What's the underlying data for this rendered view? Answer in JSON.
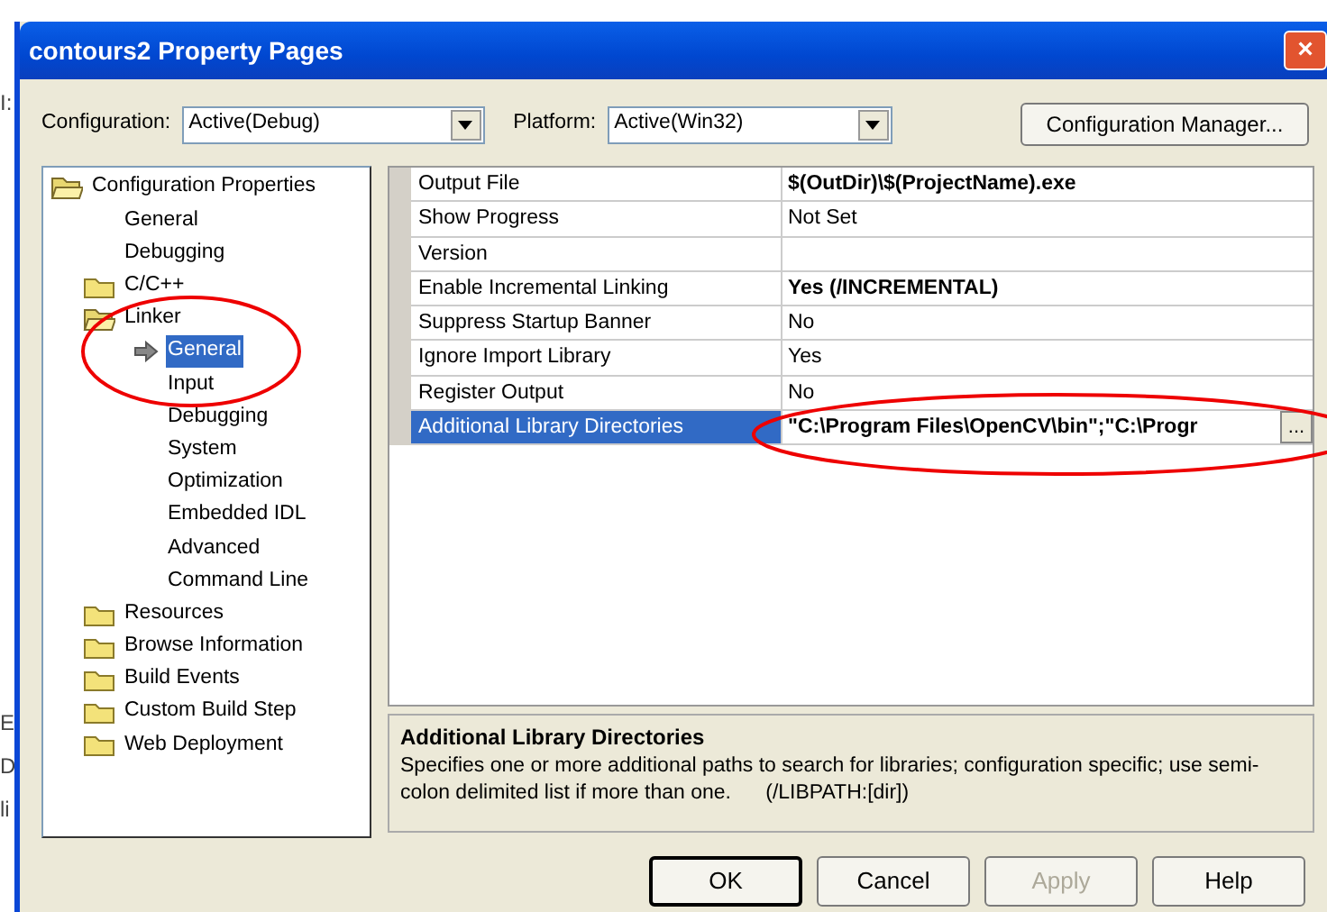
{
  "background_fragments": [
    "I:",
    "E",
    "D",
    "li"
  ],
  "window": {
    "title": "contours2 Property Pages",
    "close": "×"
  },
  "config_bar": {
    "configuration": {
      "label": "Configuration:",
      "value": "Active(Debug)"
    },
    "platform": {
      "label": "Platform:",
      "value": "Active(Win32)"
    },
    "manager_button": "Configuration Manager..."
  },
  "tree": [
    {
      "label": "Configuration Properties",
      "kind": "folder",
      "selected": false,
      "expanded": true,
      "children": [
        {
          "label": "General",
          "kind": "page",
          "selected": false
        },
        {
          "label": "Debugging",
          "kind": "page",
          "selected": false
        },
        {
          "label": "C/C++",
          "kind": "folder",
          "selected": false,
          "expanded": false
        },
        {
          "label": "Linker",
          "kind": "folder",
          "selected": false,
          "expanded": true,
          "children": [
            {
              "label": "General",
              "kind": "page",
              "selected": true
            },
            {
              "label": "Input",
              "kind": "page",
              "selected": false
            },
            {
              "label": "Debugging",
              "kind": "page",
              "selected": false
            },
            {
              "label": "System",
              "kind": "page",
              "selected": false
            },
            {
              "label": "Optimization",
              "kind": "page",
              "selected": false
            },
            {
              "label": "Embedded IDL",
              "kind": "page",
              "selected": false
            },
            {
              "label": "Advanced",
              "kind": "page",
              "selected": false
            },
            {
              "label": "Command Line",
              "kind": "page",
              "selected": false
            }
          ]
        },
        {
          "label": "Resources",
          "kind": "folder",
          "selected": false,
          "expanded": false
        },
        {
          "label": "Browse Information",
          "kind": "folder",
          "selected": false,
          "expanded": false
        },
        {
          "label": "Build Events",
          "kind": "folder",
          "selected": false,
          "expanded": false
        },
        {
          "label": "Custom Build Step",
          "kind": "folder",
          "selected": false,
          "expanded": false
        },
        {
          "label": "Web Deployment",
          "kind": "folder",
          "selected": false,
          "expanded": false
        }
      ]
    }
  ],
  "properties": [
    {
      "name": "Output File",
      "value": "$(OutDir)\\$(ProjectName).exe",
      "bold": true,
      "selected": false
    },
    {
      "name": "Show Progress",
      "value": "Not Set",
      "bold": false,
      "selected": false
    },
    {
      "name": "Version",
      "selected": false
    },
    {
      "name": "Enable Incremental Linking",
      "value": "Yes (/INCREMENTAL)",
      "bold": true,
      "selected": false
    },
    {
      "name": "Suppress Startup Banner",
      "value": "No",
      "bold": false,
      "selected": false
    },
    {
      "name": "Ignore Import Library",
      "value": "Yes",
      "bold": false,
      "selected": false
    },
    {
      "name": "Register Output",
      "value": "No",
      "bold": false,
      "selected": false
    },
    {
      "name": "Additional Library Directories",
      "value": "\"C:\\Program Files\\OpenCV\\bin\";\"C:\\Progr",
      "bold": true,
      "selected": true,
      "browse": "..."
    }
  ],
  "description": {
    "title": "Additional Library Directories",
    "text": "Specifies one or more additional paths to search for libraries; configuration specific; use semi-colon delimited list if more than one.      (/LIBPATH:[dir])"
  },
  "buttons": [
    {
      "label": "OK",
      "disabled": false,
      "default": true
    },
    {
      "label": "Cancel",
      "disabled": false,
      "default": false
    },
    {
      "label": "Apply",
      "disabled": true,
      "default": false
    },
    {
      "label": "Help",
      "disabled": false,
      "default": false
    }
  ]
}
